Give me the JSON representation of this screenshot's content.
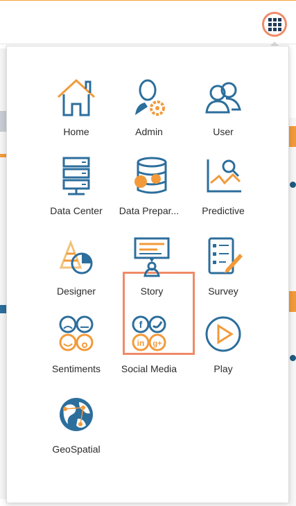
{
  "app_menu": {
    "items": [
      {
        "label": "Home",
        "icon": "home-icon"
      },
      {
        "label": "Admin",
        "icon": "admin-icon"
      },
      {
        "label": "User",
        "icon": "user-icon"
      },
      {
        "label": "Data Center",
        "icon": "data-center-icon"
      },
      {
        "label": "Data Prepar...",
        "icon": "data-preparation-icon"
      },
      {
        "label": "Predictive",
        "icon": "predictive-icon"
      },
      {
        "label": "Designer",
        "icon": "designer-icon"
      },
      {
        "label": "Story",
        "icon": "story-icon"
      },
      {
        "label": "Survey",
        "icon": "survey-icon"
      },
      {
        "label": "Sentiments",
        "icon": "sentiments-icon"
      },
      {
        "label": "Social Media",
        "icon": "social-media-icon"
      },
      {
        "label": "Play",
        "icon": "play-icon"
      },
      {
        "label": "GeoSpatial",
        "icon": "geospatial-icon"
      }
    ],
    "selected": "Story"
  },
  "colors": {
    "accent": "#ef8a68",
    "icon_blue": "#2c6e9c",
    "icon_orange": "#f29a3a",
    "topbar_border": "#f2a33a"
  }
}
